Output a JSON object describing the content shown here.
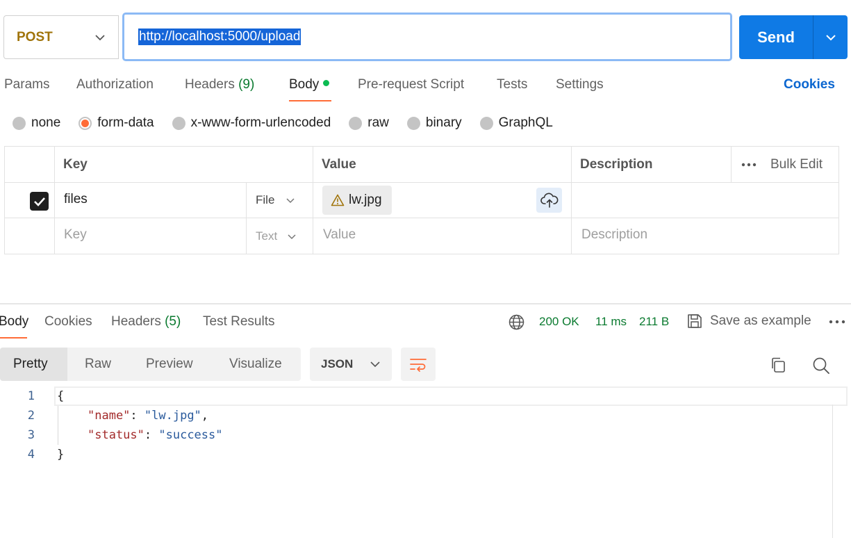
{
  "request": {
    "method": "POST",
    "url": "http://localhost:5000/upload",
    "send_label": "Send"
  },
  "request_tabs": {
    "params": "Params",
    "authorization": "Authorization",
    "headers": "Headers",
    "headers_count": "(9)",
    "body": "Body",
    "prerequest": "Pre-request Script",
    "tests": "Tests",
    "settings": "Settings",
    "cookies": "Cookies"
  },
  "body_types": {
    "none": "none",
    "form_data": "form-data",
    "urlencoded": "x-www-form-urlencoded",
    "raw": "raw",
    "binary": "binary",
    "graphql": "GraphQL",
    "selected": "form-data"
  },
  "form_table": {
    "headers": {
      "key": "Key",
      "value": "Value",
      "description": "Description",
      "bulk_edit": "Bulk Edit"
    },
    "rows": [
      {
        "key": "files",
        "type": "File",
        "value": "lw.jpg",
        "checked": true
      }
    ],
    "placeholders": {
      "key": "Key",
      "type": "Text",
      "value": "Value",
      "description": "Description"
    }
  },
  "response": {
    "tabs": {
      "body": "Body",
      "cookies": "Cookies",
      "headers": "Headers",
      "headers_count": "(5)",
      "test_results": "Test Results"
    },
    "status": "200 OK",
    "time": "11 ms",
    "size": "211 B",
    "save_label": "Save as example",
    "views": {
      "pretty": "Pretty",
      "raw": "Raw",
      "preview": "Preview",
      "visualize": "Visualize"
    },
    "format": "JSON",
    "code": {
      "line_numbers": [
        "1",
        "2",
        "3",
        "4"
      ],
      "open_brace": "{",
      "close_brace": "}",
      "entries": [
        {
          "key": "\"name\"",
          "value": "\"lw.jpg\"",
          "trailing": ","
        },
        {
          "key": "\"status\"",
          "value": "\"success\"",
          "trailing": ""
        }
      ]
    }
  },
  "colors": {
    "accent_orange": "#ff6c37",
    "send_blue": "#0f7ae5",
    "status_green": "#0a7a2f",
    "method_post": "#a0740a",
    "link_blue": "#0b66d0"
  },
  "icons": [
    "chevron-down-icon",
    "check-icon",
    "warning-icon",
    "cloud-upload-icon",
    "more-horizontal-icon",
    "globe-icon",
    "save-icon",
    "wrap-lines-icon",
    "copy-icon",
    "search-icon"
  ]
}
